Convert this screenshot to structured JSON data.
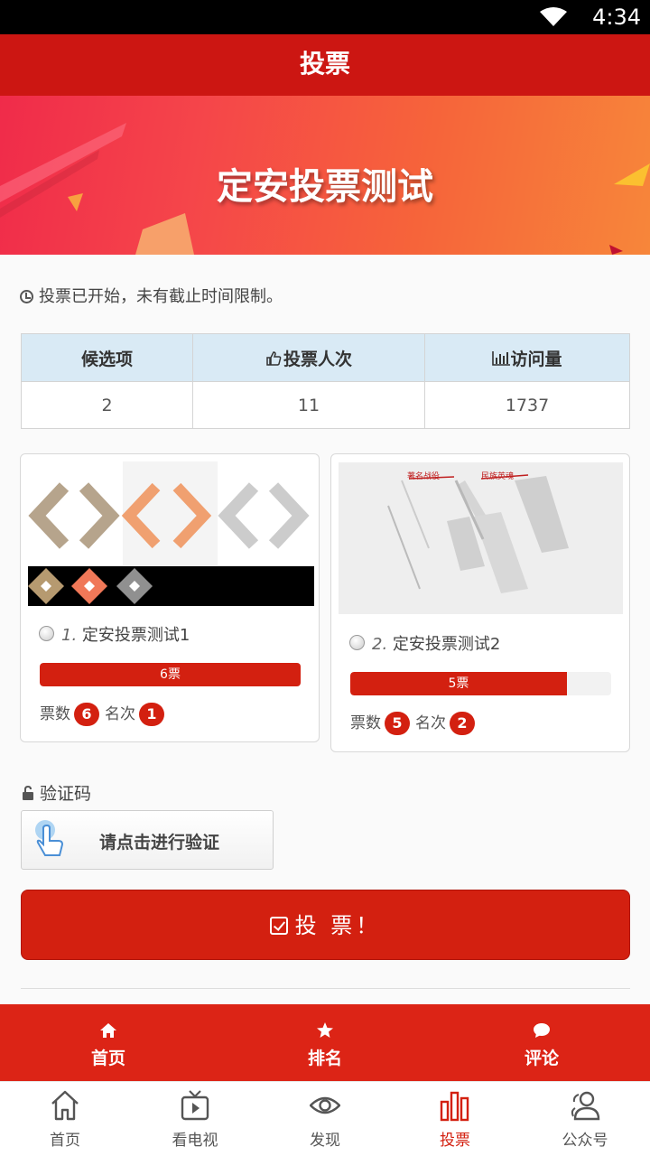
{
  "status_bar": {
    "time": "4:34"
  },
  "app_bar": {
    "title": "投票"
  },
  "banner": {
    "title": "定安投票测试"
  },
  "notice": "投票已开始，未有截止时间限制。",
  "stats": {
    "headers": [
      "候选项",
      "投票人次",
      "访问量"
    ],
    "values": [
      "2",
      "11",
      "1737"
    ]
  },
  "candidates": [
    {
      "index": "1.",
      "name": "定安投票测试1",
      "votes_label": "6票",
      "votes": 6,
      "share": 1.0,
      "votes_text": "票数",
      "votes_badge": "6",
      "rank_text": "名次",
      "rank": "1"
    },
    {
      "index": "2.",
      "name": "定安投票测试2",
      "votes_label": "5票",
      "votes": 5,
      "share": 0.83,
      "votes_text": "票数",
      "votes_badge": "5",
      "rank_text": "名次",
      "rank": "2"
    }
  ],
  "candidate2_image_text": [
    "著名战役",
    "民族英魂"
  ],
  "captcha": {
    "label": "验证码",
    "button": "请点击进行验证"
  },
  "vote_button": "投 票！",
  "sub_nav": [
    "首页",
    "排名",
    "评论"
  ],
  "tab_bar": [
    "首页",
    "看电视",
    "发现",
    "投票",
    "公众号"
  ],
  "colors": {
    "primary": "#d32010",
    "header": "#cc1612",
    "table_header": "#d9eaf5"
  }
}
